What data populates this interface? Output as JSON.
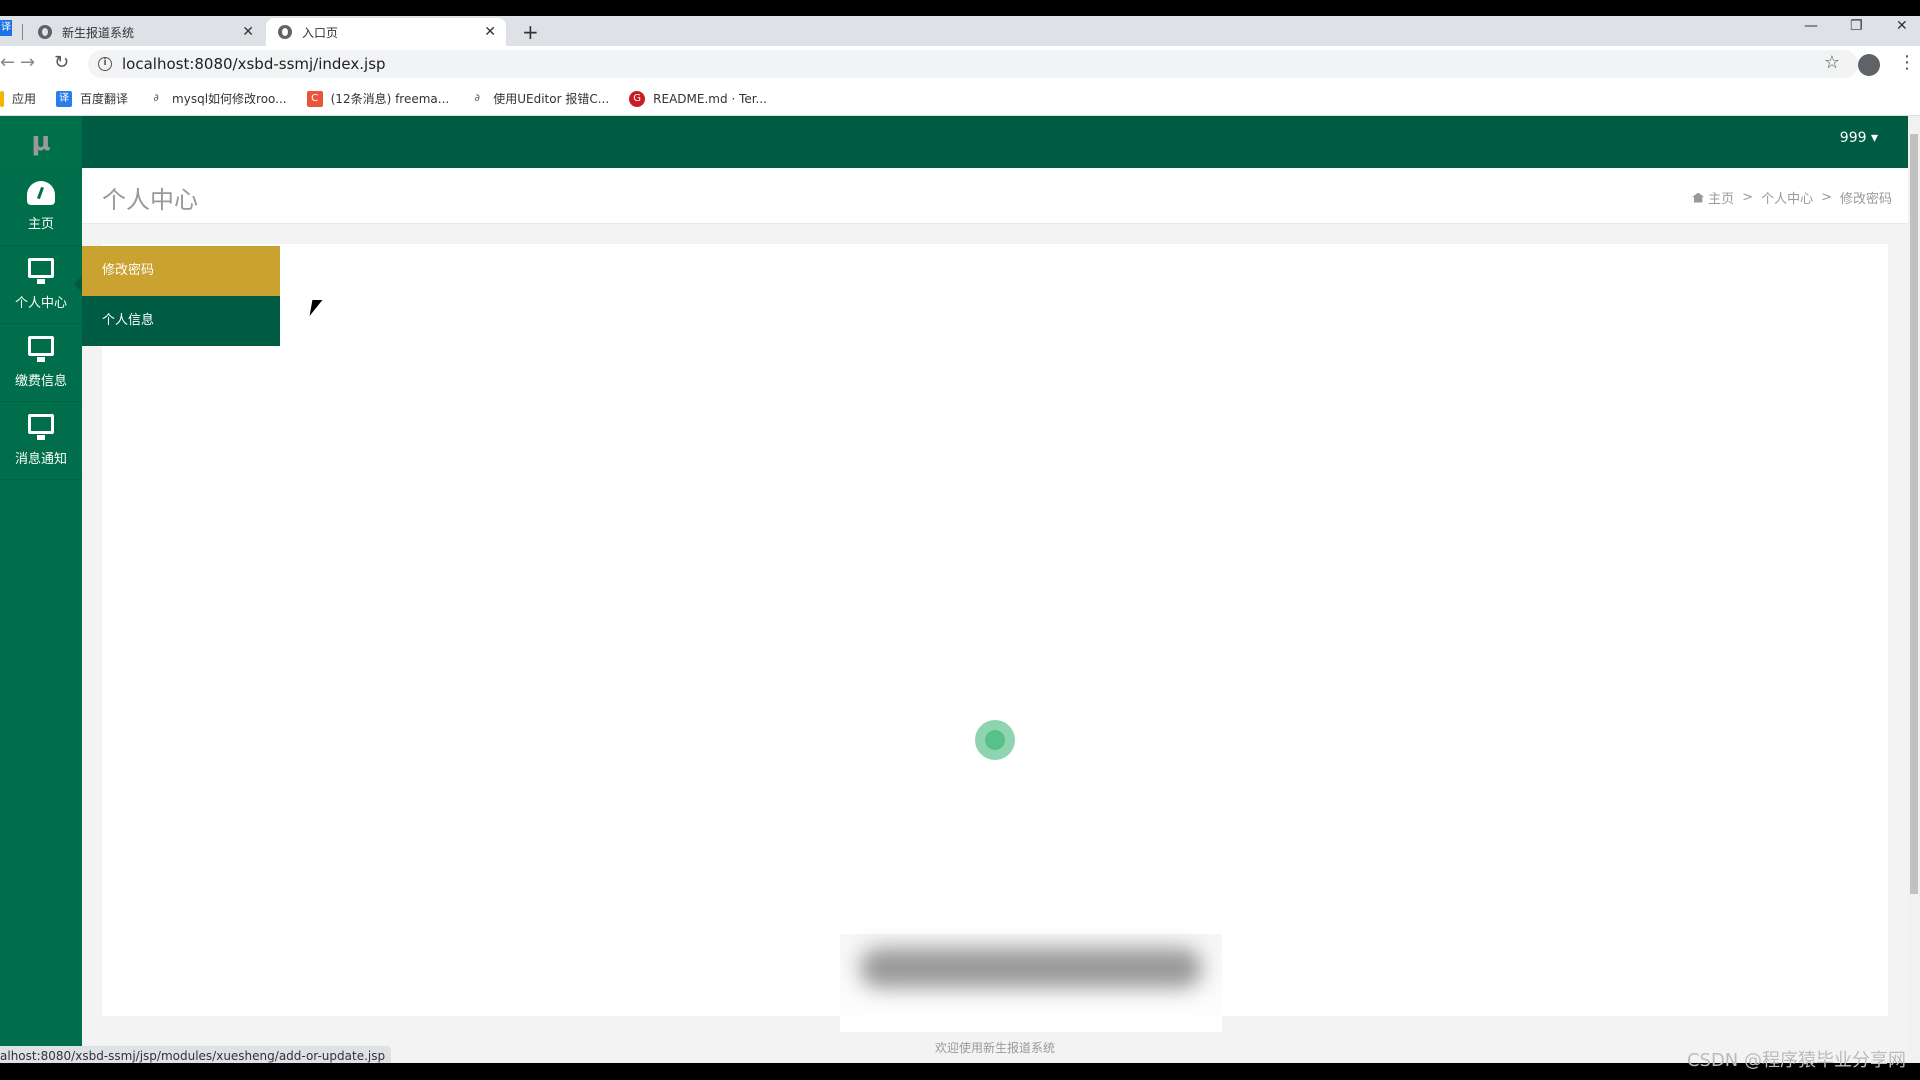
{
  "browser": {
    "tabs": [
      {
        "title": "新生报道系统",
        "active": false
      },
      {
        "title": "入口页",
        "active": true
      }
    ],
    "new_tab_icon": "+",
    "url": "localhost:8080/xsbd-ssmj/index.jsp",
    "bookmarks": [
      {
        "label": "应用",
        "icon": "apps-icon",
        "color": "#f4b400"
      },
      {
        "label": "百度翻译",
        "icon": "translate-icon",
        "color": "#2b7de9"
      },
      {
        "label": "mysql如何修改roo...",
        "icon": "link-icon",
        "color": "#555555"
      },
      {
        "label": "(12条消息) freema...",
        "icon": "csdn-icon",
        "color": "#e8553b"
      },
      {
        "label": "使用UEditor 报错C...",
        "icon": "link-icon",
        "color": "#555555"
      },
      {
        "label": "README.md · Ter...",
        "icon": "gitee-icon",
        "color": "#c71d23"
      }
    ],
    "status_url": "alhost:8080/xsbd-ssmj/jsp/modules/xuesheng/add-or-update.jsp"
  },
  "app": {
    "logo": "μ",
    "user_menu": "999 ▾",
    "sidebar": [
      {
        "label": "主页",
        "icon": "dashboard-icon",
        "active": false
      },
      {
        "label": "个人中心",
        "icon": "monitor-icon",
        "active": true
      },
      {
        "label": "缴费信息",
        "icon": "monitor-icon",
        "active": false
      },
      {
        "label": "消息通知",
        "icon": "monitor-icon",
        "active": false
      }
    ],
    "submenu": [
      {
        "label": "修改密码",
        "active": true
      },
      {
        "label": "个人信息",
        "active": false
      }
    ],
    "page_title": "个人中心",
    "breadcrumb": [
      "主页",
      "个人中心",
      "修改密码"
    ],
    "breadcrumb_sep": ">",
    "footer": "欢迎使用新生报道系统",
    "watermark": "CSDN @程序猿毕业分享网"
  },
  "colors": {
    "sidebar": "#006e4a",
    "topnav": "#005c42",
    "submenu_active": "#c9a22f",
    "loader": "#58c08b"
  }
}
